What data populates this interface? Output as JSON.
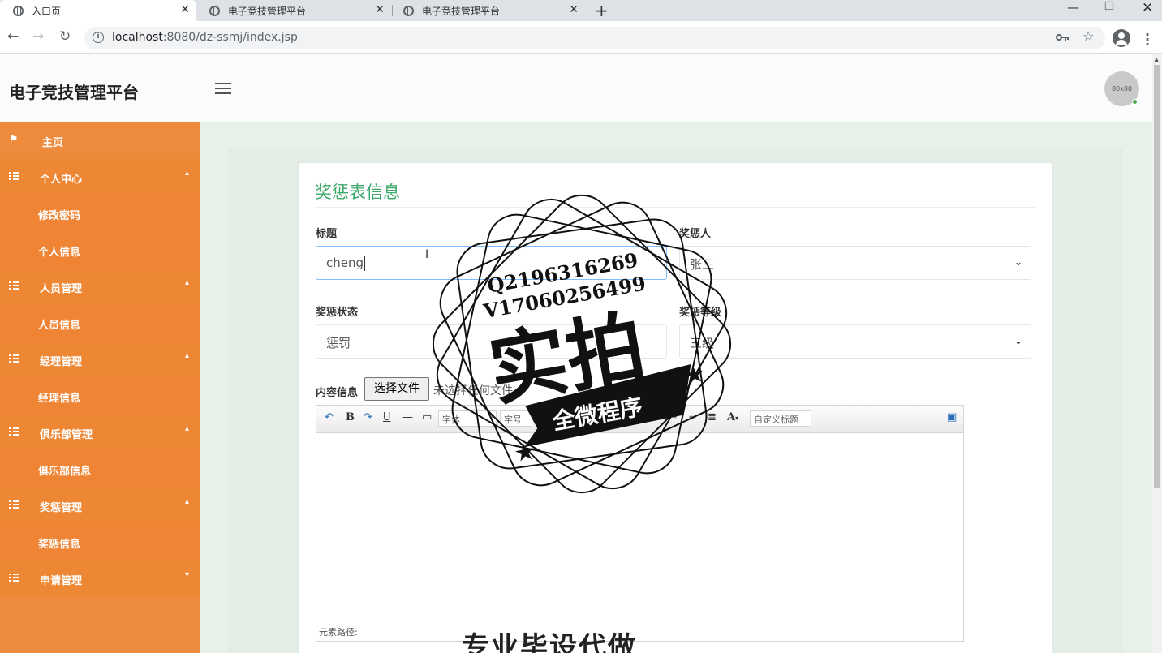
{
  "browser": {
    "tabs": [
      {
        "title": "入口页"
      },
      {
        "title": "电子竞技管理平台"
      },
      {
        "title": "电子竞技管理平台"
      }
    ],
    "url_host": "localhost",
    "url_path": ":8080/dz-ssmj/index.jsp"
  },
  "header": {
    "brand": "电子竞技管理平台",
    "avatar_text": "80x80"
  },
  "sidebar": {
    "home": "主页",
    "groups": [
      {
        "label": "个人中心",
        "items": [
          "修改密码",
          "个人信息"
        ]
      },
      {
        "label": "人员管理",
        "items": [
          "人员信息"
        ]
      },
      {
        "label": "经理管理",
        "items": [
          "经理信息"
        ]
      },
      {
        "label": "俱乐部管理",
        "items": [
          "俱乐部信息"
        ]
      },
      {
        "label": "奖惩管理",
        "items": [
          "奖惩信息"
        ]
      },
      {
        "label": "申请管理",
        "items": []
      }
    ]
  },
  "form": {
    "title": "奖惩表信息",
    "fields": {
      "title_label": "标题",
      "title_value": "cheng",
      "person_label": "奖惩人",
      "person_value": "张三",
      "status_label": "奖惩状态",
      "status_value": "惩罚",
      "level_label": "奖惩等级",
      "level_value": "三级",
      "content_label": "内容信息",
      "file_button": "选择文件",
      "file_none": "未选择任何文件"
    },
    "editor": {
      "font_family": "字体",
      "font_size": "字号",
      "custom_title": "自定义标题",
      "path_label": "元素路径:"
    }
  },
  "watermark": {
    "line1": "Q2196316269",
    "line2": "V17060256499",
    "big": "实拍",
    "banner": "全微程序",
    "bottom": "专业毕设代做"
  }
}
